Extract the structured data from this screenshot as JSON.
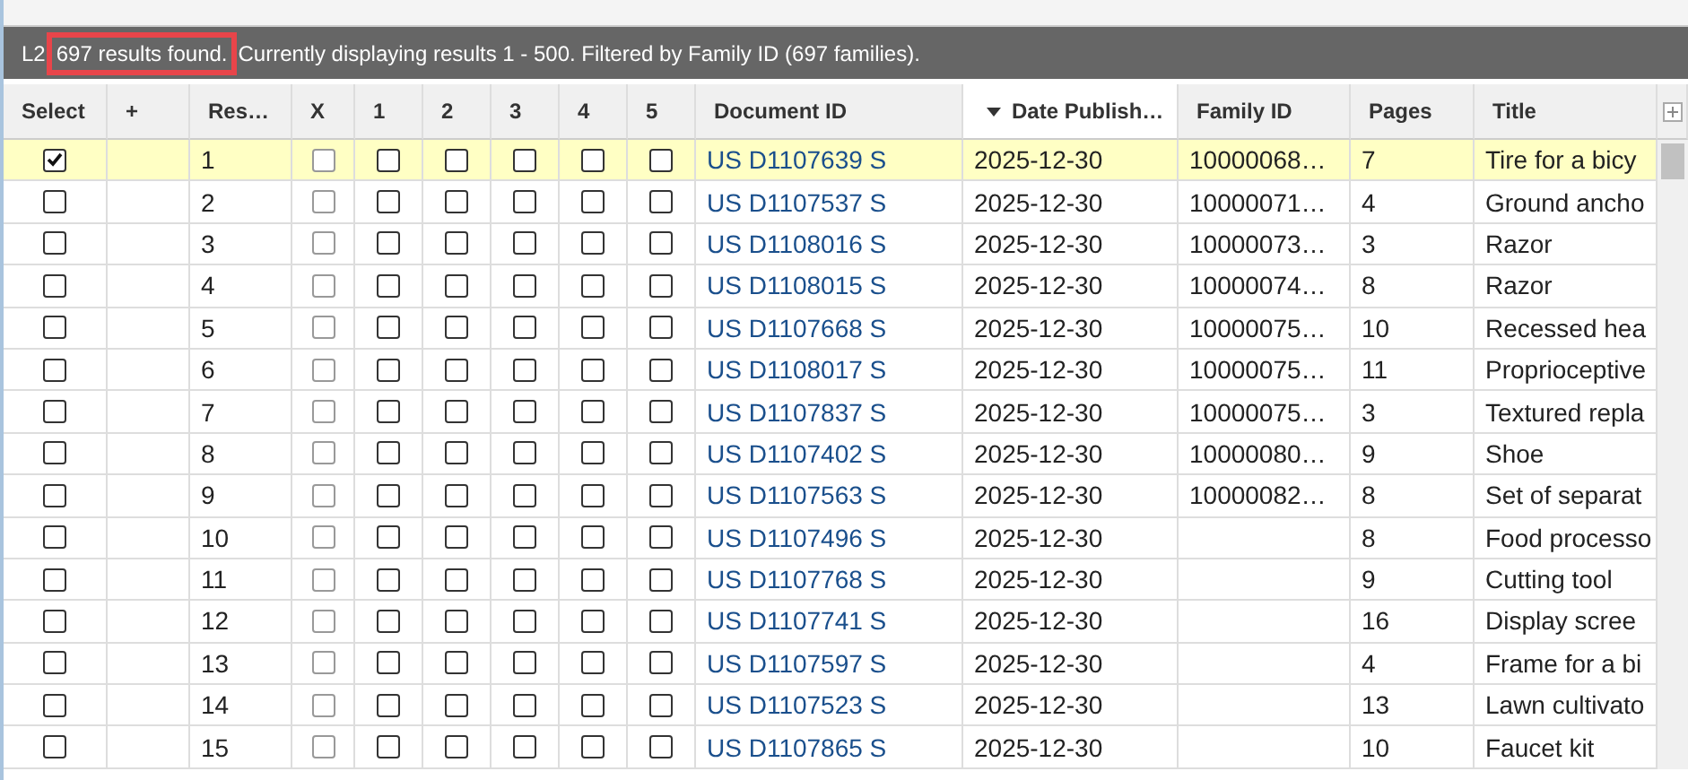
{
  "status_bar": {
    "prefix": "L2",
    "highlighted_text": "697 results found.",
    "highlighted": true,
    "rest": "Currently displaying results 1 - 500. Filtered by Family ID (697 families)."
  },
  "table": {
    "columns": [
      {
        "label": "Select",
        "kind": "text",
        "sorted": false
      },
      {
        "label": "+",
        "kind": "text",
        "sorted": false
      },
      {
        "label": "Res…",
        "kind": "text",
        "sorted": false
      },
      {
        "label": "X",
        "kind": "text",
        "sorted": false
      },
      {
        "label": "1",
        "kind": "text",
        "sorted": false
      },
      {
        "label": "2",
        "kind": "text",
        "sorted": false
      },
      {
        "label": "3",
        "kind": "text",
        "sorted": false
      },
      {
        "label": "4",
        "kind": "text",
        "sorted": false
      },
      {
        "label": "5",
        "kind": "text",
        "sorted": false
      },
      {
        "label": "Document ID",
        "kind": "text",
        "sorted": false
      },
      {
        "label": "Date Publish…",
        "kind": "text",
        "sorted": true
      },
      {
        "label": "Family ID",
        "kind": "text",
        "sorted": false
      },
      {
        "label": "Pages",
        "kind": "text",
        "sorted": false
      },
      {
        "label": "Title",
        "kind": "text",
        "sorted": false
      }
    ],
    "rows": [
      {
        "selected": true,
        "excluded": false,
        "ratings": [
          false,
          false,
          false,
          false,
          false
        ],
        "result": "1",
        "document_id": "US D1107639 S",
        "date": "2025-12-30",
        "family_id": "10000068…",
        "pages": "7",
        "title": "Tire for a bicy"
      },
      {
        "selected": false,
        "excluded": false,
        "ratings": [
          false,
          false,
          false,
          false,
          false
        ],
        "result": "2",
        "document_id": "US D1107537 S",
        "date": "2025-12-30",
        "family_id": "10000071…",
        "pages": "4",
        "title": "Ground ancho"
      },
      {
        "selected": false,
        "excluded": false,
        "ratings": [
          false,
          false,
          false,
          false,
          false
        ],
        "result": "3",
        "document_id": "US D1108016 S",
        "date": "2025-12-30",
        "family_id": "10000073…",
        "pages": "3",
        "title": "Razor"
      },
      {
        "selected": false,
        "excluded": false,
        "ratings": [
          false,
          false,
          false,
          false,
          false
        ],
        "result": "4",
        "document_id": "US D1108015 S",
        "date": "2025-12-30",
        "family_id": "10000074…",
        "pages": "8",
        "title": "Razor"
      },
      {
        "selected": false,
        "excluded": false,
        "ratings": [
          false,
          false,
          false,
          false,
          false
        ],
        "result": "5",
        "document_id": "US D1107668 S",
        "date": "2025-12-30",
        "family_id": "10000075…",
        "pages": "10",
        "title": "Recessed hea"
      },
      {
        "selected": false,
        "excluded": false,
        "ratings": [
          false,
          false,
          false,
          false,
          false
        ],
        "result": "6",
        "document_id": "US D1108017 S",
        "date": "2025-12-30",
        "family_id": "10000075…",
        "pages": "11",
        "title": "Proprioceptive"
      },
      {
        "selected": false,
        "excluded": false,
        "ratings": [
          false,
          false,
          false,
          false,
          false
        ],
        "result": "7",
        "document_id": "US D1107837 S",
        "date": "2025-12-30",
        "family_id": "10000075…",
        "pages": "3",
        "title": "Textured repla"
      },
      {
        "selected": false,
        "excluded": false,
        "ratings": [
          false,
          false,
          false,
          false,
          false
        ],
        "result": "8",
        "document_id": "US D1107402 S",
        "date": "2025-12-30",
        "family_id": "10000080…",
        "pages": "9",
        "title": "Shoe"
      },
      {
        "selected": false,
        "excluded": false,
        "ratings": [
          false,
          false,
          false,
          false,
          false
        ],
        "result": "9",
        "document_id": "US D1107563 S",
        "date": "2025-12-30",
        "family_id": "10000082…",
        "pages": "8",
        "title": "Set of separat"
      },
      {
        "selected": false,
        "excluded": false,
        "ratings": [
          false,
          false,
          false,
          false,
          false
        ],
        "result": "10",
        "document_id": "US D1107496 S",
        "date": "2025-12-30",
        "pages": "8",
        "title": "Food processo"
      },
      {
        "selected": false,
        "excluded": false,
        "ratings": [
          false,
          false,
          false,
          false,
          false
        ],
        "result": "11",
        "document_id": "US D1107768 S",
        "date": "2025-12-30",
        "pages": "9",
        "title": "Cutting tool"
      },
      {
        "selected": false,
        "excluded": false,
        "ratings": [
          false,
          false,
          false,
          false,
          false
        ],
        "result": "12",
        "document_id": "US D1107741 S",
        "date": "2025-12-30",
        "pages": "16",
        "title": "Display scree"
      },
      {
        "selected": false,
        "excluded": false,
        "ratings": [
          false,
          false,
          false,
          false,
          false
        ],
        "result": "13",
        "document_id": "US D1107597 S",
        "date": "2025-12-30",
        "pages": "4",
        "title": "Frame for a bi"
      },
      {
        "selected": false,
        "excluded": false,
        "ratings": [
          false,
          false,
          false,
          false,
          false
        ],
        "result": "14",
        "document_id": "US D1107523 S",
        "date": "2025-12-30",
        "pages": "13",
        "title": "Lawn cultivato"
      },
      {
        "selected": false,
        "excluded": false,
        "ratings": [
          false,
          false,
          false,
          false,
          false
        ],
        "result": "15",
        "document_id": "US D1107865 S",
        "date": "2025-12-30",
        "pages": "10",
        "title": "Faucet kit"
      }
    ]
  }
}
